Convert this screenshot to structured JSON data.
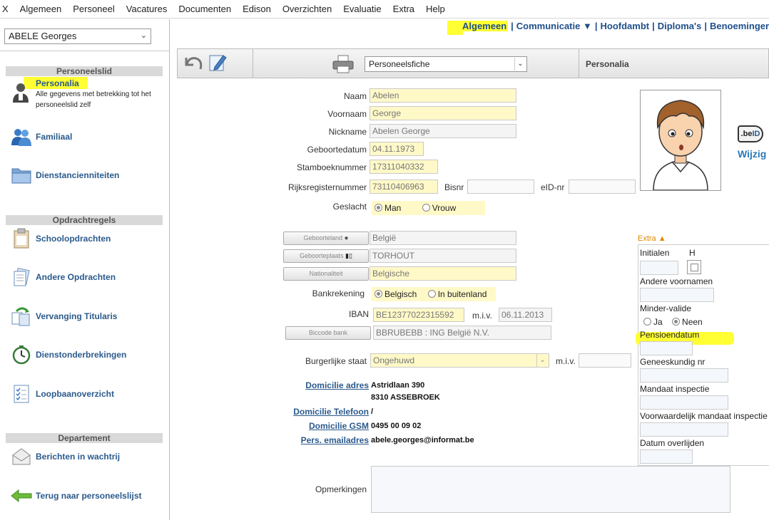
{
  "menu": [
    "X",
    "Algemeen",
    "Personeel",
    "Vacatures",
    "Documenten",
    "Edison",
    "Overzichten",
    "Evaluatie",
    "Extra",
    "Help"
  ],
  "person": {
    "selected": "ABELE Georges"
  },
  "sidebar": {
    "section1": "Personeelslid",
    "personalia": {
      "label": "Personalia",
      "desc1": "Alle gegevens met betrekking tot het",
      "desc2": "personeelslid zelf"
    },
    "items1": [
      {
        "label": "Familiaal",
        "icon": "people-icon"
      },
      {
        "label": "Dienstancienniteiten",
        "icon": "folder-icon"
      }
    ],
    "section2": "Opdrachtregels",
    "items2": [
      {
        "label": "Schoolopdrachten",
        "icon": "clipboard-icon"
      },
      {
        "label": "Andere Opdrachten",
        "icon": "documents-icon"
      },
      {
        "label": "Vervanging Titularis",
        "icon": "swap-icon"
      },
      {
        "label": "Dienstonderbrekingen",
        "icon": "clock-icon"
      },
      {
        "label": "Loopbaanoverzicht",
        "icon": "checklist-icon"
      }
    ],
    "section3": "Departement",
    "items3": [
      {
        "label": "Berichten in wachtrij",
        "icon": "envelope-icon"
      },
      {
        "label": "Terug naar personeelslijst",
        "icon": "arrow-left-icon"
      }
    ]
  },
  "topnav": {
    "active": "Algemeen",
    "items": [
      "Communicatie ▼",
      "Hoofdambt",
      "Diploma's",
      "Benoeminger"
    ]
  },
  "toolbar": {
    "fiche": "Personeelsfiche",
    "title": "Personalia"
  },
  "form": {
    "naam": {
      "label": "Naam",
      "value": "Abelen"
    },
    "voornaam": {
      "label": "Voornaam",
      "value": "George"
    },
    "nickname": {
      "label": "Nickname",
      "value": "Abelen George"
    },
    "geboortedatum": {
      "label": "Geboortedatum",
      "value": "04.11.1973"
    },
    "stamboeknummer": {
      "label": "Stamboeknummer",
      "value": "17311040332"
    },
    "rijksregisternummer": {
      "label": "Rijksregisternummer",
      "value": "73110406963"
    },
    "bisnr": {
      "label": "Bisnr",
      "value": ""
    },
    "eid": {
      "label": "eID-nr",
      "value": ""
    },
    "geslacht": {
      "label": "Geslacht",
      "options": [
        "Man",
        "Vrouw"
      ],
      "selected": "Man"
    },
    "geboorteland": {
      "button": "Geboorteland",
      "value": "België"
    },
    "geboorteplaats": {
      "button": "Geboorteplaats",
      "value": "TORHOUT"
    },
    "nationaliteit": {
      "button": "Nationaliteit",
      "value": "Belgische"
    },
    "bankrekening": {
      "label": "Bankrekening",
      "options": [
        "Belgisch",
        "In buitenland"
      ],
      "selected": "Belgisch"
    },
    "iban": {
      "label": "IBAN",
      "value": "BE12377022315592",
      "miv_label": "m.i.v.",
      "miv": "06.11.2013"
    },
    "bic": {
      "button": "Biccode bank",
      "value": "BBRUBEBB : ING België N.V."
    },
    "burgerlijke_staat": {
      "label": "Burgerlijke staat",
      "value": "Ongehuwd",
      "miv_label": "m.i.v.",
      "miv": ""
    },
    "domicilie_adres": {
      "label": "Domicilie adres",
      "line1": "Astridlaan 390",
      "line2": "8310 ASSEBROEK"
    },
    "domicilie_telefoon": {
      "label": "Domicilie Telefoon",
      "value": "/"
    },
    "domicilie_gsm": {
      "label": "Domicilie GSM",
      "value": "0495 00 09 02"
    },
    "emailadres": {
      "label": "Pers. emailadres",
      "value": "abele.georges@informat.be"
    },
    "opmerkingen": {
      "label": "Opmerkingen",
      "value": ""
    }
  },
  "eid_card": {
    "logo": ".be",
    "link": "Wijzig"
  },
  "extra": {
    "title": "Extra ▲",
    "initialen": "Initialen",
    "h": "H",
    "andere_voornamen": "Andere voornamen",
    "minder_valide": "Minder-valide",
    "ja": "Ja",
    "neen": "Neen",
    "pensioendatum": "Pensioendatum",
    "geneeskundig_nr": "Geneeskundig nr",
    "mandaat_inspectie": "Mandaat inspectie",
    "voorwaardelijk": "Voorwaardelijk mandaat inspectie",
    "datum_overlijden": "Datum overlijden"
  },
  "colors": {
    "highlight": "#ffff33",
    "link": "#2b5a8c",
    "field": "#fff9c8"
  }
}
